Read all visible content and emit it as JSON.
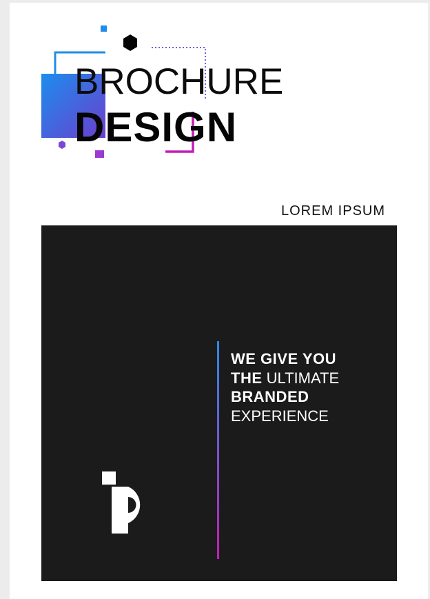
{
  "header": {
    "title_line1": "BROCHURE",
    "title_line2": "DESIGN"
  },
  "subheading": "LOREM IPSUM",
  "panel": {
    "tagline": {
      "line1": "WE GIVE YOU",
      "line2_bold": "THE",
      "line2_light": "ULTIMATE",
      "line3": "BRANDED",
      "line4": "EXPERIENCE"
    },
    "logo_icon": "p-letter-logo-icon"
  },
  "colors": {
    "accent_blue": "#1e8de9",
    "accent_purple": "#8a3cc9",
    "accent_magenta": "#c21fb4",
    "panel_bg": "#1b1b1b"
  }
}
